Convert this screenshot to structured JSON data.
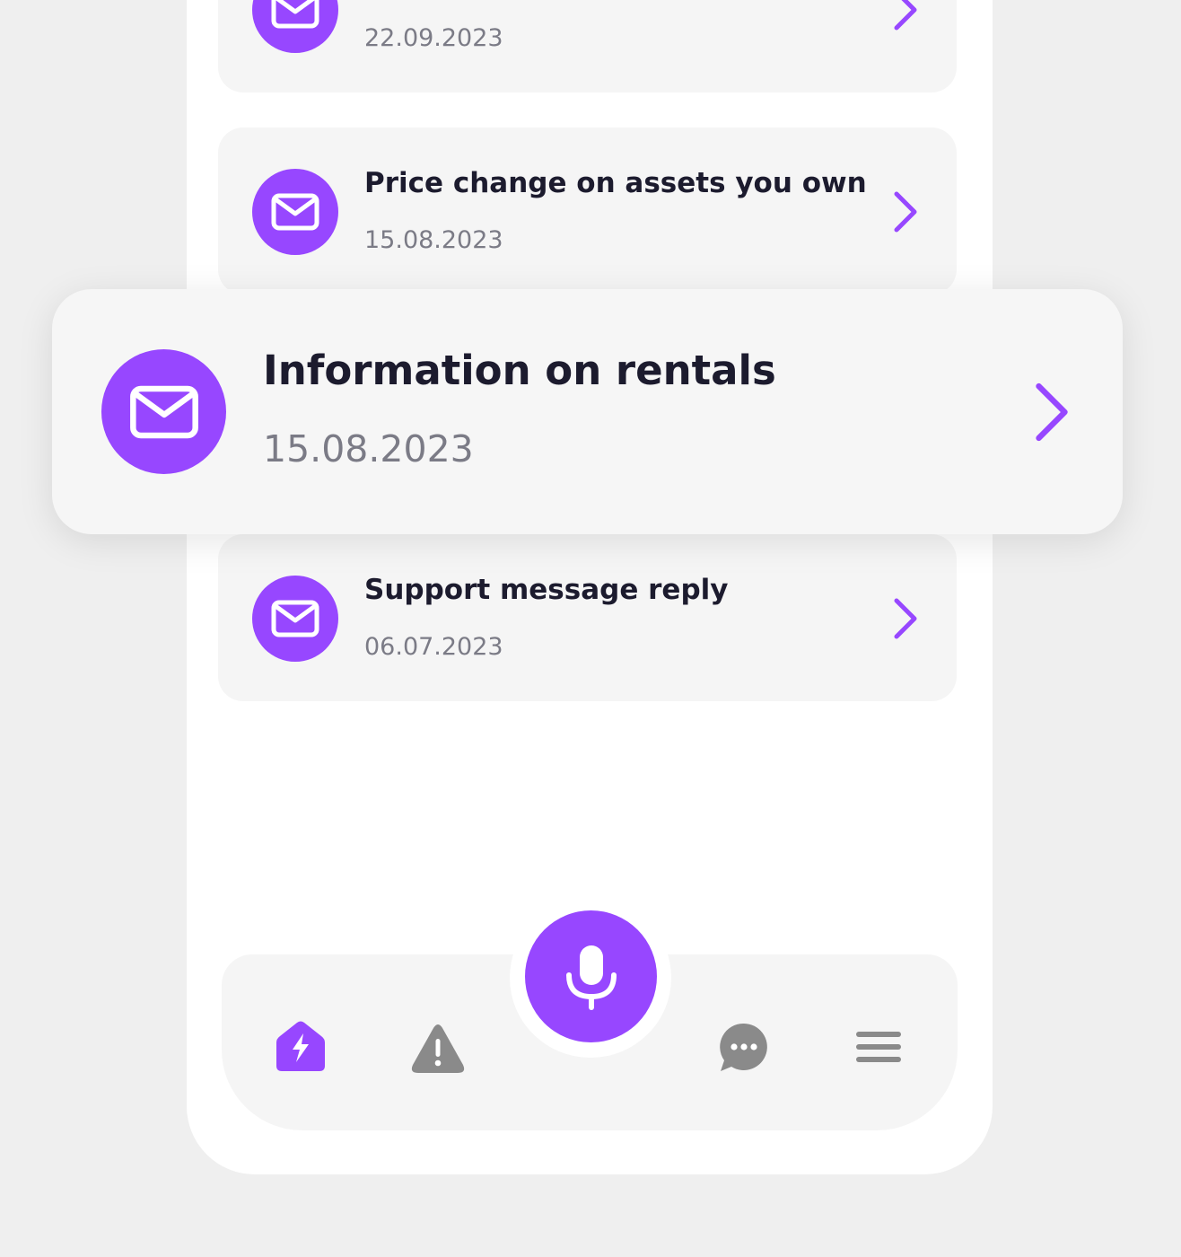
{
  "colors": {
    "accent": "#9747ff",
    "card_bg": "#f5f5f5",
    "title_text": "#1c1b2e",
    "date_text": "#7b7b86",
    "nav_inactive": "#8a8a8a"
  },
  "notifications": [
    {
      "title": "",
      "date": "22.09.2023",
      "icon": "mail-icon"
    },
    {
      "title": "Price change on assets you own",
      "date": "15.08.2023",
      "icon": "mail-icon"
    },
    {
      "title": "Information on rentals",
      "date": "15.08.2023",
      "icon": "mail-icon"
    },
    {
      "title": "Support message reply",
      "date": "06.07.2023",
      "icon": "mail-icon"
    }
  ],
  "nav": {
    "items": [
      {
        "name": "home",
        "icon": "home-bolt-icon",
        "active": true
      },
      {
        "name": "alerts",
        "icon": "warning-icon",
        "active": false
      },
      {
        "name": "voice",
        "icon": "microphone-icon",
        "active": false
      },
      {
        "name": "chat",
        "icon": "chat-bubble-icon",
        "active": false
      },
      {
        "name": "menu",
        "icon": "menu-icon",
        "active": false
      }
    ]
  }
}
